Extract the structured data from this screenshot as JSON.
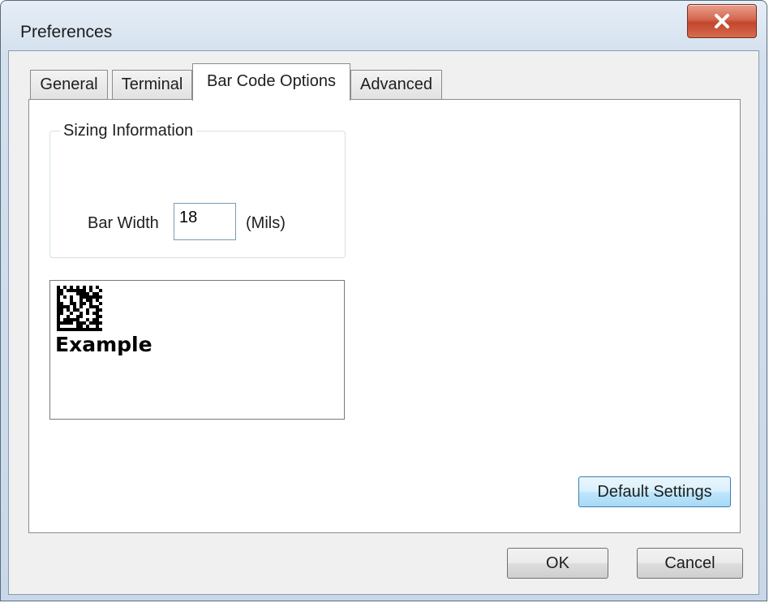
{
  "window": {
    "title": "Preferences"
  },
  "tabs": [
    {
      "label": "General"
    },
    {
      "label": "Terminal"
    },
    {
      "label": "Bar Code Options"
    },
    {
      "label": "Advanced"
    }
  ],
  "active_tab": "Bar Code Options",
  "sizing": {
    "legend": "Sizing Information",
    "bar_width_label": "Bar Width",
    "bar_width_value": "18",
    "unit": "(Mils)"
  },
  "preview": {
    "caption": "Example"
  },
  "buttons": {
    "default_settings": "Default Settings",
    "ok": "OK",
    "cancel": "Cancel"
  },
  "colors": {
    "close_button": "#c2462d",
    "focus_border": "#3c7fb1",
    "window_frame": "#d3e0ee"
  },
  "icons": {
    "close": "close-x-icon"
  }
}
